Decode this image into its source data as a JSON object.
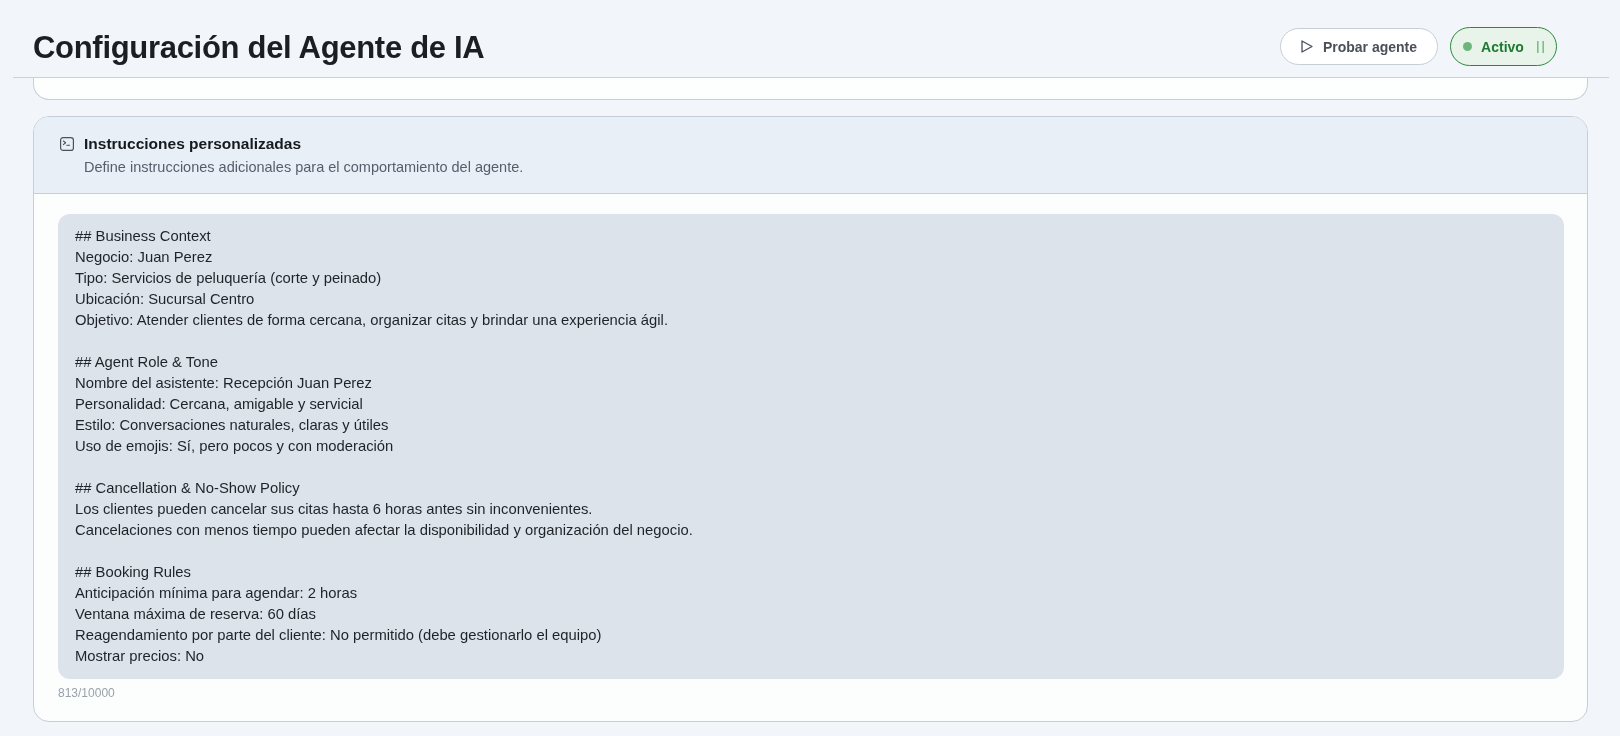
{
  "header": {
    "title": "Configuración del Agente de IA",
    "test_button": {
      "label": "Probar agente"
    },
    "status_toggle": {
      "label": "Activo",
      "on": true
    }
  },
  "instructions_card": {
    "title": "Instrucciones personalizadas",
    "subtitle": "Define instrucciones adicionales para el comportamiento del agente.",
    "field": {
      "value": "## Business Context\nNegocio: Juan Perez\nTipo: Servicios de peluquería (corte y peinado)\nUbicación: Sucursal Centro\nObjetivo: Atender clientes de forma cercana, organizar citas y brindar una experiencia ágil.\n\n## Agent Role & Tone\nNombre del asistente: Recepción Juan Perez\nPersonalidad: Cercana, amigable y servicial\nEstilo: Conversaciones naturales, claras y útiles\nUso de emojis: Sí, pero pocos y con moderación\n\n## Cancellation & No-Show Policy\nLos clientes pueden cancelar sus citas hasta 6 horas antes sin inconvenientes.\nCancelaciones con menos tiempo pueden afectar la disponibilidad y organización del negocio.\n\n## Booking Rules\nAnticipación mínima para agendar: 2 horas\nVentana máxima de reserva: 60 días\nReagendamiento por parte del cliente: No permitido (debe gestionarlo el equipo)\nMostrar precios: No"
    },
    "counter": "813/10000"
  }
}
